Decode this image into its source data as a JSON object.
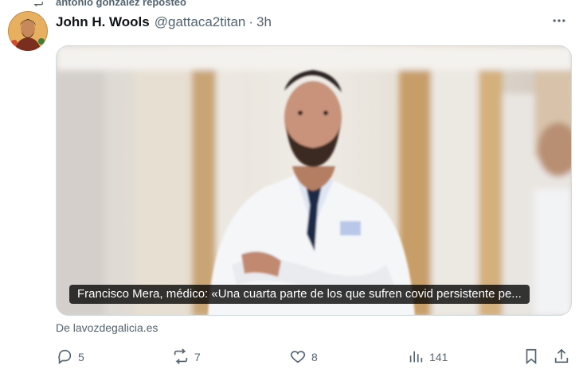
{
  "repost": {
    "label": "antonio gonzalez reposteó",
    "icon": "repost-icon"
  },
  "tweet": {
    "author_name": "John H. Wools",
    "handle": "@gattaca2titan",
    "separator": "·",
    "time": "3h",
    "more_icon": "more-icon"
  },
  "card": {
    "caption": "Francisco Mera, médico: «Una cuarta parte de los que sufren covid persistente pe...",
    "source": "De lavozdegalicia.es"
  },
  "actions": {
    "replies": "5",
    "reposts": "7",
    "likes": "8",
    "views": "141"
  },
  "colors": {
    "text_secondary": "#536471",
    "text_primary": "#0f1419",
    "border": "#cfd9de"
  }
}
